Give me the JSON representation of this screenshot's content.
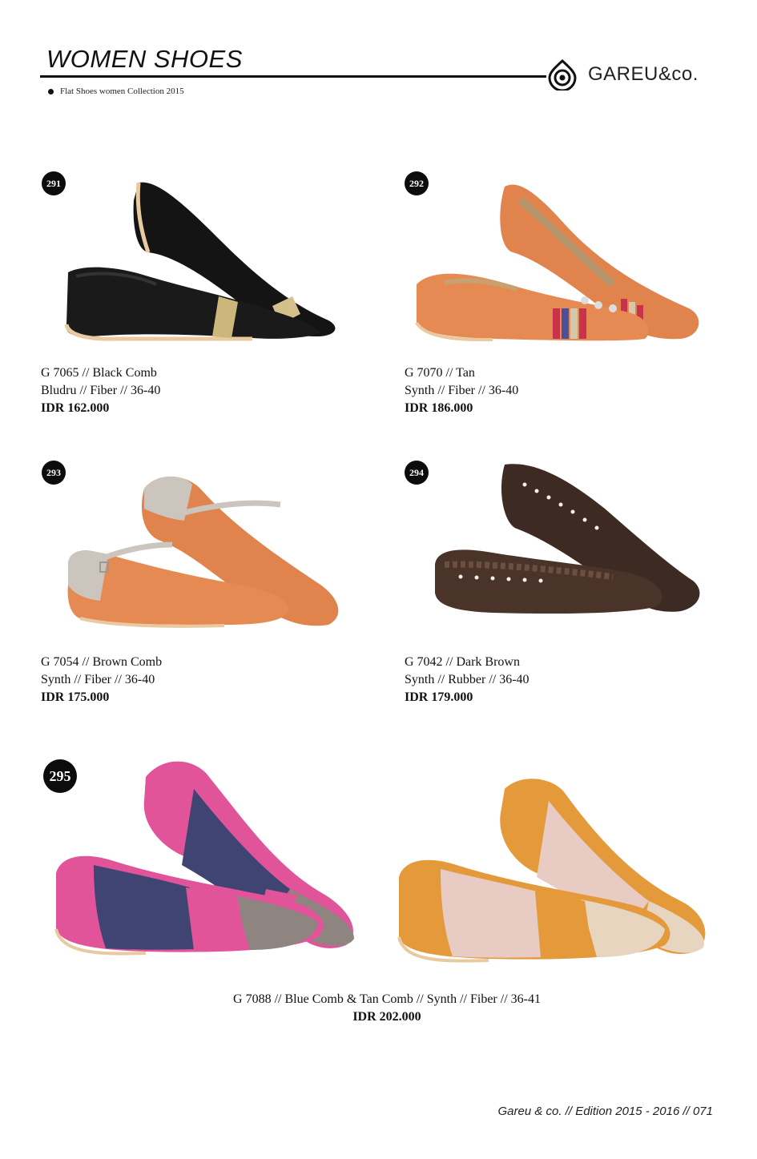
{
  "header": {
    "title": "WOMEN SHOES",
    "subtitle": "Flat Shoes women Collection 2015",
    "brand": "GAREU&co."
  },
  "products": [
    {
      "number": "291",
      "line1": "G 7065   //  Black Comb",
      "line2": "Bludru   //   Fiber  //  36-40",
      "price": "IDR 162.000"
    },
    {
      "number": "292",
      "line1": "G 7070   //  Tan",
      "line2": "Synth   //   Fiber  //  36-40",
      "price": "IDR 186.000"
    },
    {
      "number": "293",
      "line1": "G 7054  //  Brown Comb",
      "line2": "Synth   //   Fiber  //  36-40",
      "price": "IDR 175.000"
    },
    {
      "number": "294",
      "line1": "G 7042  //  Dark Brown",
      "line2": "Synth   //   Rubber  //  36-40",
      "price": "IDR 179.000"
    },
    {
      "number": "295",
      "line1": "G 7088  //  Blue Comb & Tan Comb  //  Synth  //  Fiber  //  36-41",
      "price": "IDR 202.000"
    }
  ],
  "footer": "Gareu & co. //  Edition  2015 - 2016  // 071",
  "colors": {
    "black_suede": "#141414",
    "gold_band": "#c9b27a",
    "tan": "#e0834c",
    "stripe_red": "#c8324a",
    "stripe_blue": "#4c4f9c",
    "grey_suede": "#cbc5bd",
    "dark_brown": "#3d2a22",
    "pink": "#e2549a",
    "navy": "#3f4473",
    "taupe": "#8e8580",
    "mustard": "#e49a3a",
    "blush": "#e8cbc3",
    "sole": "#e9c9a0"
  }
}
